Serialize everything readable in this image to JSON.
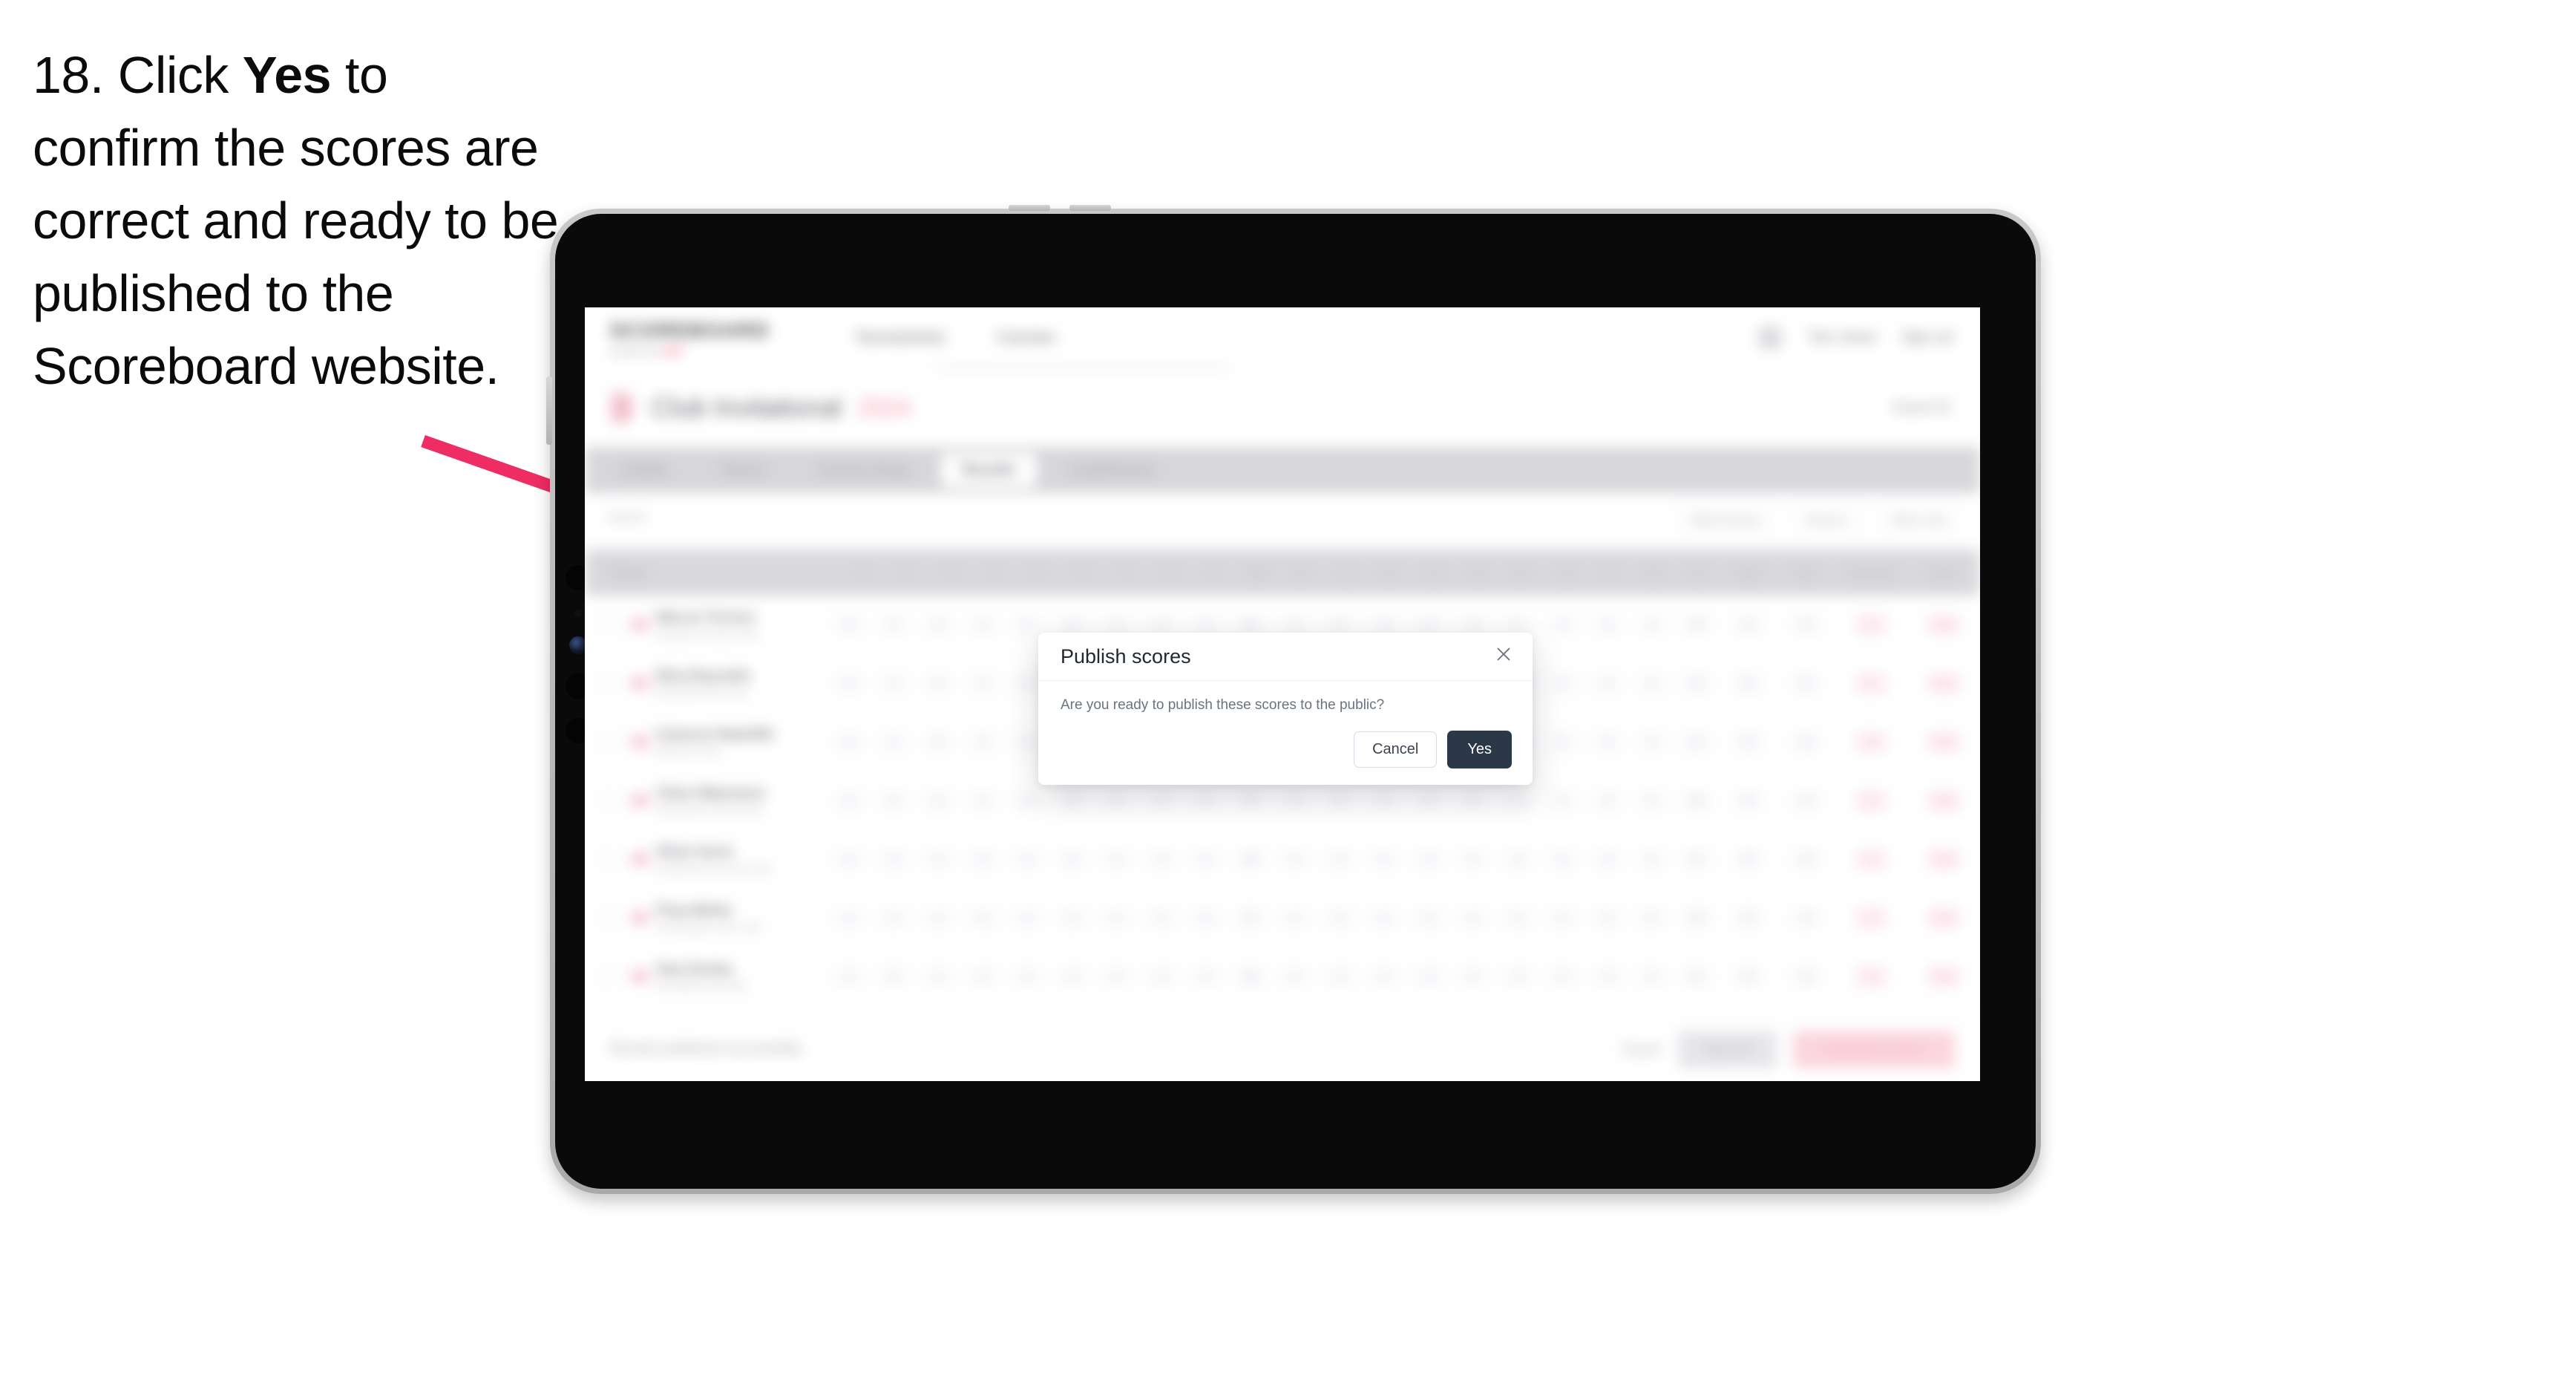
{
  "instruction": {
    "step_number": "18.",
    "text_before_bold": " Click ",
    "bold_word": "Yes",
    "text_after_bold": " to confirm the scores are correct and ready to be published to the Scoreboard website."
  },
  "annotation": {
    "arrow_color": "#ee2d62",
    "arrow_name": "pointer-arrow-to-yes-button"
  },
  "app": {
    "brand": {
      "wordmark": "SCOREBOARD",
      "subtitle_left": "powered by",
      "subtitle_accent": "Golf"
    },
    "topnav": {
      "links": [
        "Tournaments",
        "Courses"
      ],
      "user_name": "Tom Jones",
      "sign_out": "Sign out"
    },
    "page": {
      "title": "Club Invitational",
      "title_badge": "2024",
      "right_meta": "Event ID"
    },
    "tabs": [
      {
        "label": "Details",
        "active": false
      },
      {
        "label": "Teams",
        "active": false
      },
      {
        "label": "Course Setup",
        "active": false
      },
      {
        "label": "Results",
        "active": true
      },
      {
        "label": "Leaderboard",
        "active": false
      }
    ],
    "filters": {
      "search_placeholder": "Search",
      "chips": [
        "Flight Division",
        "Round 1",
        "Table View"
      ]
    },
    "table": {
      "headers": {
        "player": "Player",
        "holes": [
          "1",
          "2",
          "3",
          "4",
          "5",
          "6",
          "7",
          "8",
          "9",
          "OUT",
          "10",
          "11",
          "12",
          "13",
          "14",
          "15",
          "16",
          "17",
          "18",
          "IN"
        ],
        "total": "Total",
        "net": "Net",
        "handicap": "Handicap",
        "status": "Status"
      },
      "rows": [
        {
          "player_name": "Marcus Torrens",
          "player_club": "Oakvale Country Club",
          "holes": [
            "4",
            "5",
            "4",
            "3",
            "5",
            "4",
            "4",
            "3",
            "4",
            "36",
            "4",
            "5",
            "3",
            "4",
            "4",
            "5",
            "4",
            "3",
            "4",
            "36"
          ],
          "total": "72",
          "net": "70",
          "handicap": "2.4",
          "status": "Final"
        },
        {
          "player_name": "Eliza Reynolds",
          "player_club": "Ravenhill Golf Links",
          "holes": [
            "5",
            "4",
            "4",
            "4",
            "5",
            "3",
            "4",
            "4",
            "5",
            "38",
            "4",
            "4",
            "4",
            "5",
            "3",
            "4",
            "5",
            "4",
            "4",
            "37"
          ],
          "total": "75",
          "net": "71",
          "handicap": "4.1",
          "status": "Final"
        },
        {
          "player_name": "Cameron Radcliffe",
          "player_club": "Bellmont Park",
          "holes": [
            "4",
            "4",
            "5",
            "3",
            "4",
            "5",
            "4",
            "3",
            "5",
            "37",
            "5",
            "4",
            "4",
            "4",
            "4",
            "4",
            "5",
            "3",
            "4",
            "37"
          ],
          "total": "74",
          "net": "70",
          "handicap": "3.8",
          "status": "Final"
        },
        {
          "player_name": "Chloe Watermere",
          "player_club": "Silverbrook Golf Resort",
          "holes": [
            "4",
            "5",
            "3",
            "4",
            "4",
            "4",
            "5",
            "4",
            "4",
            "37",
            "4",
            "5",
            "4",
            "3",
            "5",
            "4",
            "4",
            "4",
            "5",
            "38"
          ],
          "total": "75",
          "net": "72",
          "handicap": "3.1",
          "status": "Final"
        },
        {
          "player_name": "Oliver Hurst",
          "player_club": "Kingsmead Country Club",
          "holes": [
            "5",
            "4",
            "4",
            "4",
            "4",
            "5",
            "4",
            "4",
            "4",
            "38",
            "4",
            "4",
            "5",
            "4",
            "4",
            "3",
            "5",
            "4",
            "4",
            "37"
          ],
          "total": "75",
          "net": "73",
          "handicap": "2.0",
          "status": "Final"
        },
        {
          "player_name": "Priya Mehta",
          "player_club": "Harrowgate Links Club",
          "holes": [
            "4",
            "4",
            "4",
            "5",
            "4",
            "4",
            "4",
            "3",
            "5",
            "37",
            "4",
            "5",
            "4",
            "4",
            "4",
            "4",
            "4",
            "4",
            "5",
            "38"
          ],
          "total": "75",
          "net": "71",
          "handicap": "4.3",
          "status": "Final"
        },
        {
          "player_name": "Sam Dooley",
          "player_club": "Northfield Golf Club",
          "holes": [
            "4",
            "5",
            "4",
            "4",
            "4",
            "4",
            "5",
            "4",
            "4",
            "38",
            "5",
            "4",
            "4",
            "4",
            "5",
            "4",
            "4",
            "3",
            "4",
            "37"
          ],
          "total": "75",
          "net": "72",
          "handicap": "3.5",
          "status": "Final"
        }
      ]
    },
    "footer": {
      "note": "Results published successfully",
      "link": "Export",
      "secondary_button": "Save All",
      "danger_button": "Unpublish scores"
    }
  },
  "modal": {
    "title": "Publish scores",
    "message": "Are you ready to publish these scores to the public?",
    "cancel_label": "Cancel",
    "confirm_label": "Yes",
    "close_icon": "close-icon",
    "confirm_color": "#2c3747"
  }
}
